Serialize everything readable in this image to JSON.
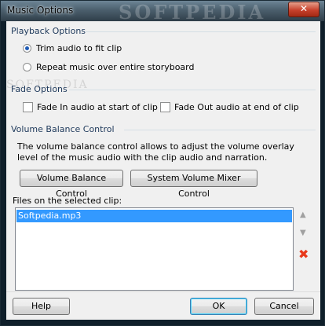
{
  "window": {
    "title": "Music Options",
    "close_glyph": "✕",
    "watermark_top": "SOFTPEDIA",
    "watermark_mid": "SOFTPEDIA"
  },
  "playback": {
    "header": "Playback Options",
    "options": [
      {
        "label": "Trim audio to fit clip",
        "selected": true
      },
      {
        "label": "Repeat music over entire storyboard",
        "selected": false
      }
    ]
  },
  "fade": {
    "header": "Fade Options",
    "fade_in_label": "Fade In audio at start of clip",
    "fade_out_label": "Fade Out audio at end of clip",
    "fade_in_checked": false,
    "fade_out_checked": false
  },
  "volume": {
    "header": "Volume Balance Control",
    "description": "The volume balance control allows to adjust the volume overlay level of the music audio with the clip audio and narration.",
    "balance_button": "Volume Balance Control",
    "mixer_button": "System Volume Mixer Control"
  },
  "files": {
    "label": "Files on the selected clip:",
    "items": [
      "Softpedia.mp3"
    ],
    "selected_index": 0,
    "move_up_icon": "▲",
    "move_down_icon": "▼",
    "delete_icon": "✖"
  },
  "footer": {
    "help": "Help",
    "ok": "OK",
    "cancel": "Cancel"
  },
  "colors": {
    "accent": "#3399ff",
    "group_title": "#1e395b",
    "delete": "#e8391b"
  }
}
